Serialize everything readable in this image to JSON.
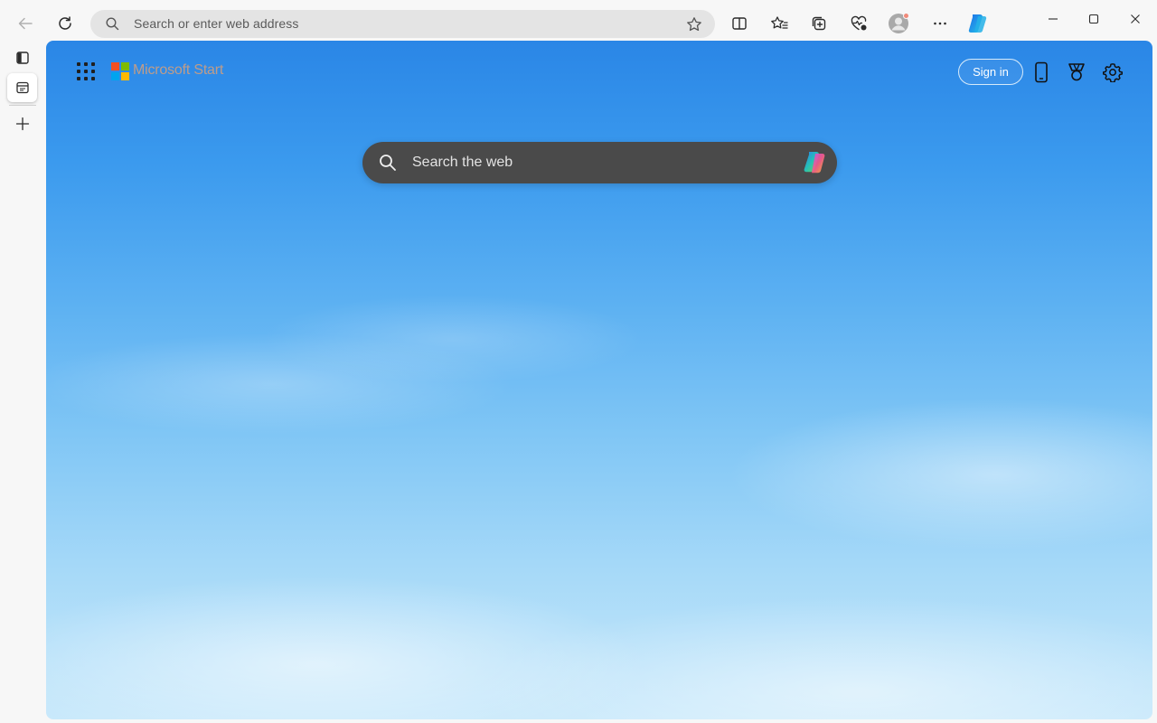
{
  "browser": {
    "address_placeholder": "Search or enter web address",
    "toolbar_icons": [
      "back-icon",
      "refresh-icon",
      "split-screen-icon",
      "favorites-icon",
      "collections-icon",
      "browser-essentials-icon",
      "profile-icon",
      "more-icon",
      "copilot-icon"
    ],
    "window_controls": [
      "minimize-icon",
      "maximize-icon",
      "close-icon"
    ]
  },
  "tabs": {
    "icons": [
      "tab-actions-icon",
      "new-tab-page-icon",
      "add-tab-icon"
    ]
  },
  "page": {
    "brand": "Microsoft Start",
    "sign_in_label": "Sign in",
    "search_placeholder": "Search the web",
    "header_icons": [
      "apps-launcher-icon",
      "phone-icon",
      "rewards-icon",
      "settings-icon"
    ],
    "logo_colors": [
      "#f25022",
      "#7fba00",
      "#00a4ef",
      "#ffb900"
    ]
  }
}
